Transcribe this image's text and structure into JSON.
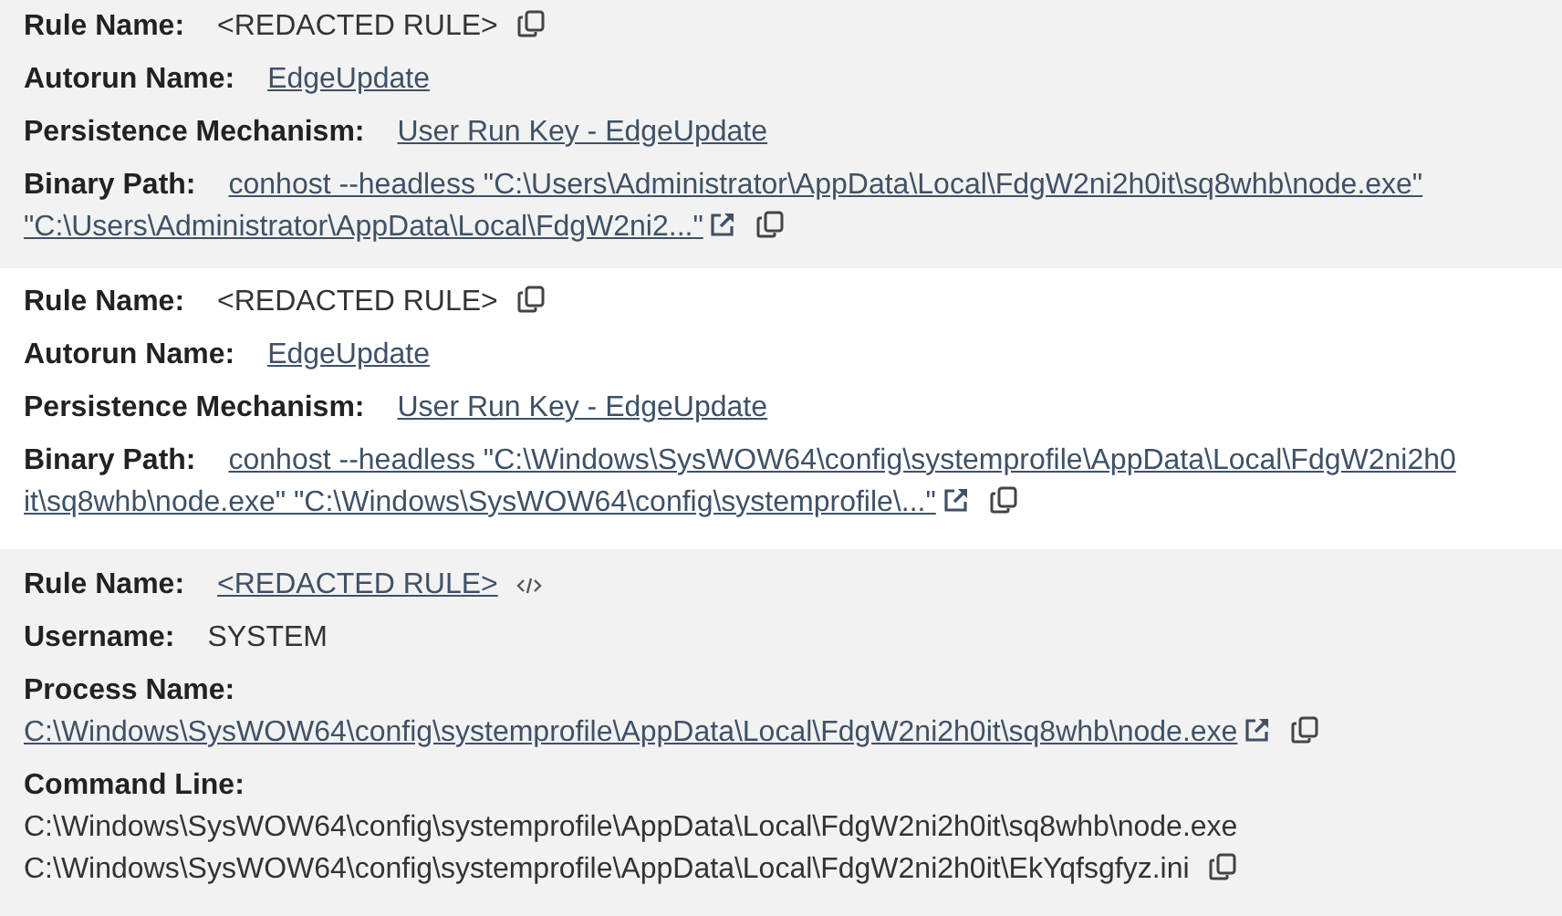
{
  "records": [
    {
      "fields": [
        {
          "label": "Rule Name:",
          "stacked": false,
          "kind": "text",
          "lines": [
            "<REDACTED RULE>"
          ],
          "actions": [
            {
              "kind": "copy"
            }
          ]
        },
        {
          "label": "Autorun Name:",
          "stacked": false,
          "kind": "link",
          "lines": [
            "EdgeUpdate"
          ]
        },
        {
          "label": "Persistence Mechanism:",
          "stacked": false,
          "kind": "link",
          "lines": [
            "User Run Key - EdgeUpdate"
          ]
        },
        {
          "label": "Binary Path:",
          "stacked": false,
          "kind": "link",
          "lines": [
            "conhost --headless \"C:\\Users\\Administrator\\AppData\\Local\\FdgW2ni2h0it\\sq8whb\\node.exe\"",
            "\"C:\\Users\\Administrator\\AppData\\Local\\FdgW2ni2...\""
          ],
          "actions": [
            {
              "kind": "external"
            },
            {
              "kind": "copy"
            }
          ]
        }
      ]
    },
    {
      "fields": [
        {
          "label": "Rule Name:",
          "stacked": false,
          "kind": "text",
          "lines": [
            "<REDACTED RULE>"
          ],
          "actions": [
            {
              "kind": "copy"
            }
          ]
        },
        {
          "label": "Autorun Name:",
          "stacked": false,
          "kind": "link",
          "lines": [
            "EdgeUpdate"
          ]
        },
        {
          "label": "Persistence Mechanism:",
          "stacked": false,
          "kind": "link",
          "lines": [
            "User Run Key - EdgeUpdate"
          ]
        },
        {
          "label": "Binary Path:",
          "stacked": false,
          "kind": "link",
          "lines": [
            "conhost --headless \"C:\\Windows\\SysWOW64\\config\\systemprofile\\AppData\\Local\\FdgW2ni2h0",
            "it\\sq8whb\\node.exe\" \"C:\\Windows\\SysWOW64\\config\\systemprofile\\...\""
          ],
          "actions": [
            {
              "kind": "external"
            },
            {
              "kind": "copy"
            }
          ]
        }
      ]
    },
    {
      "fields": [
        {
          "label": "Rule Name:",
          "stacked": false,
          "kind": "link",
          "lines": [
            "<REDACTED RULE>"
          ],
          "actions": [
            {
              "kind": "code"
            }
          ]
        },
        {
          "label": "Username:",
          "stacked": false,
          "kind": "text",
          "lines": [
            "SYSTEM"
          ]
        },
        {
          "label": "Process Name:",
          "stacked": true,
          "kind": "link",
          "lines": [
            "C:\\Windows\\SysWOW64\\config\\systemprofile\\AppData\\Local\\FdgW2ni2h0it\\sq8whb\\node.exe"
          ],
          "actions": [
            {
              "kind": "external"
            },
            {
              "kind": "copy"
            }
          ]
        },
        {
          "label": "Command Line:",
          "stacked": true,
          "kind": "text",
          "lines": [
            "C:\\Windows\\SysWOW64\\config\\systemprofile\\AppData\\Local\\FdgW2ni2h0it\\sq8whb\\node.exe",
            "C:\\Windows\\SysWOW64\\config\\systemprofile\\AppData\\Local\\FdgW2ni2h0it\\EkYqfsgfyz.ini"
          ],
          "actions": [
            {
              "kind": "copy"
            }
          ]
        }
      ]
    }
  ]
}
